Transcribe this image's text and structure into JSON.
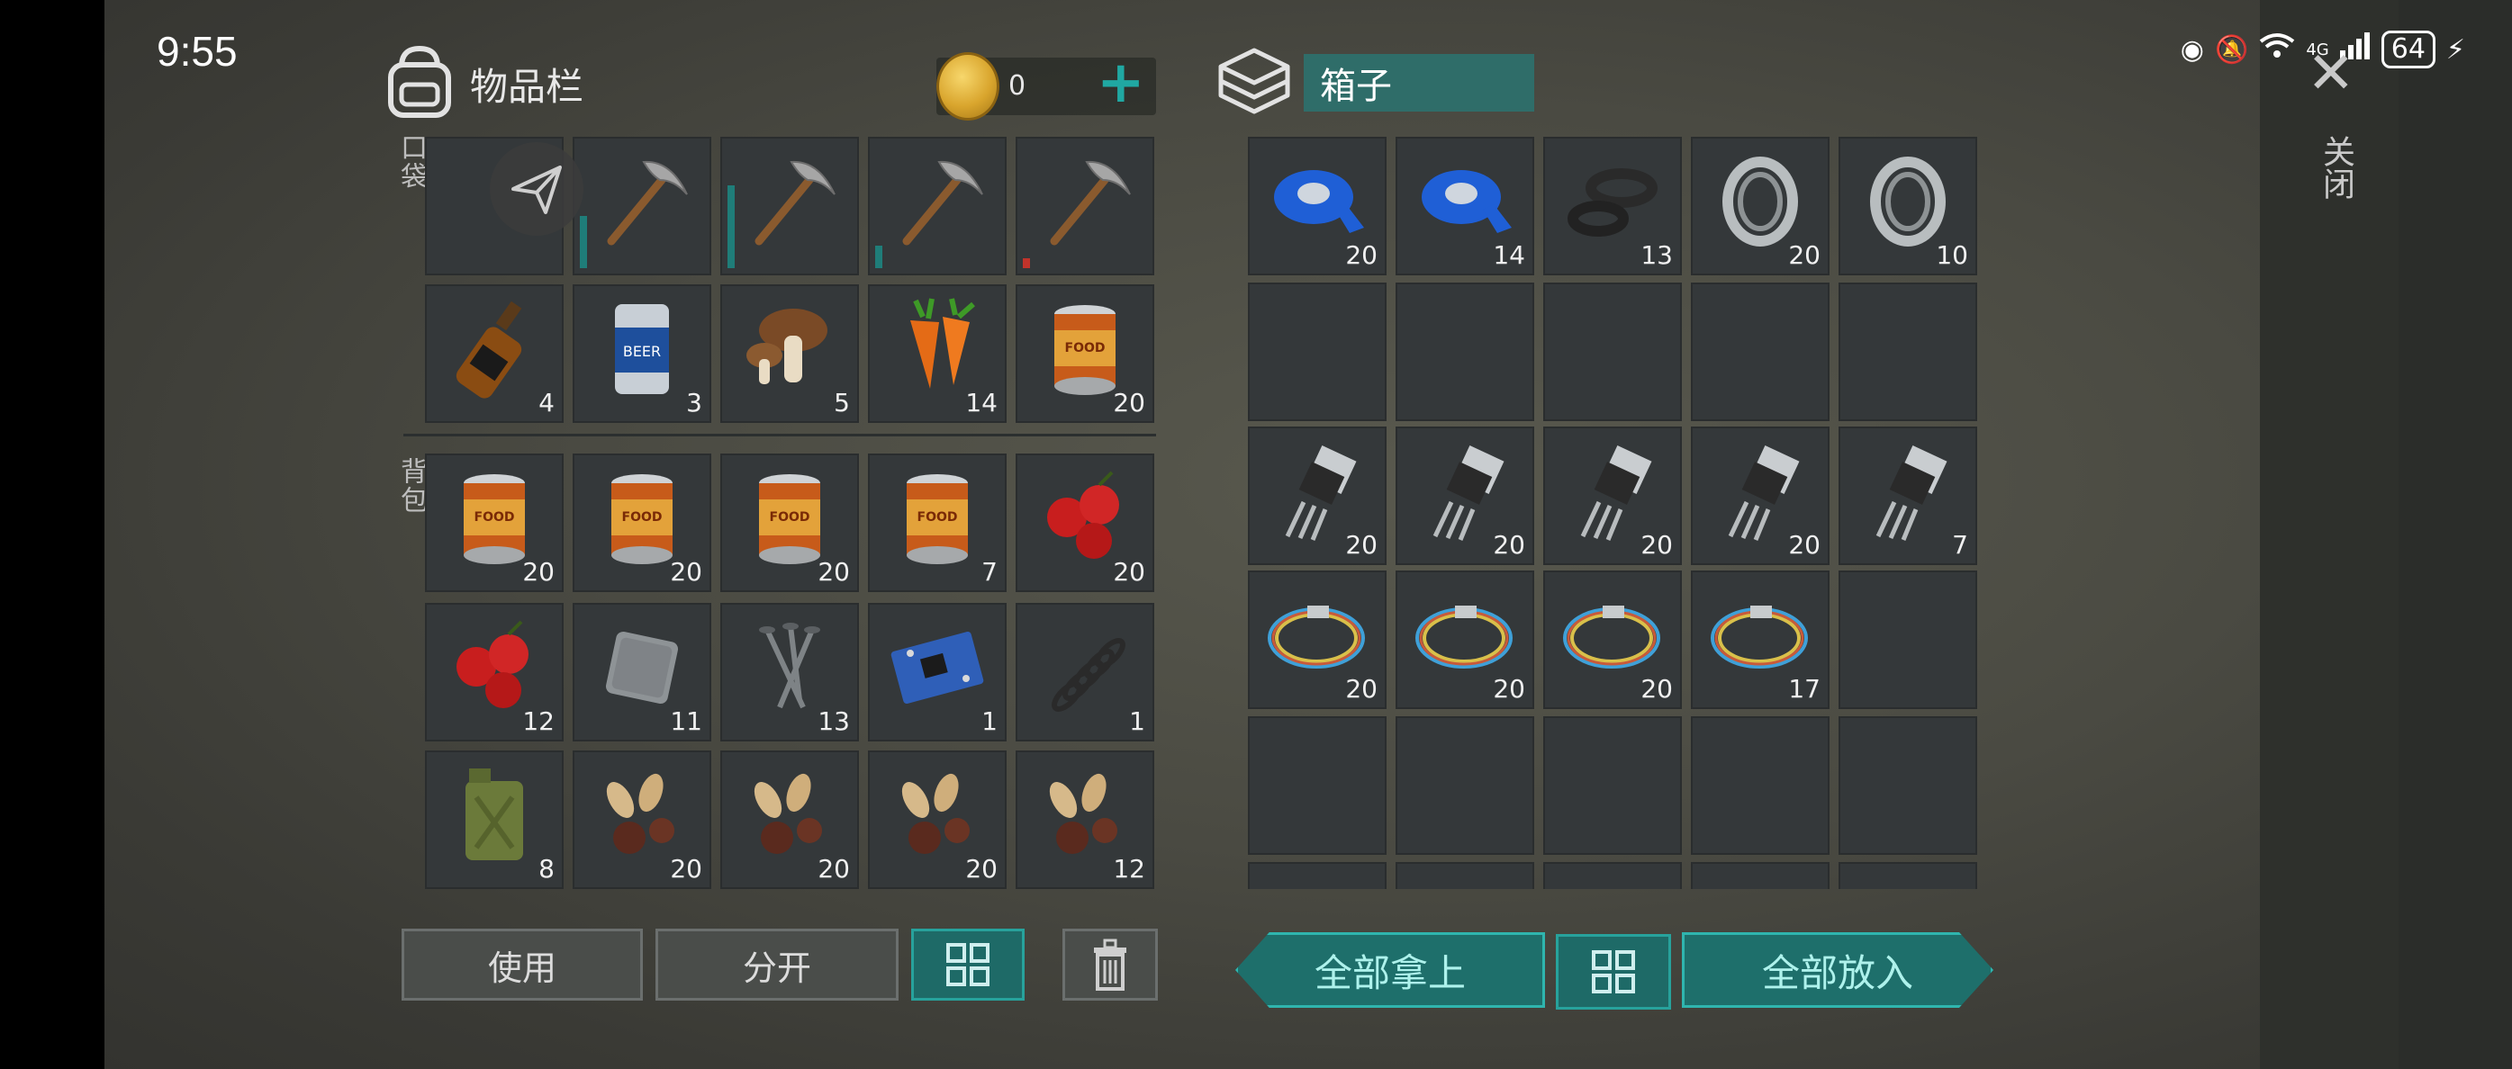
{
  "status": {
    "time": "9:55",
    "battery": "64",
    "network": "4G"
  },
  "inventory": {
    "title": "物品栏",
    "coins": "0",
    "pocket_label": "口袋",
    "backpack_label": "背包",
    "pocket": [
      {
        "icon": "pickaxe",
        "count": "",
        "durability": 0.62,
        "dur_color": "#1f7d79"
      },
      {
        "icon": "pickaxe",
        "count": "",
        "durability": 0.98,
        "dur_color": "#1f7d79"
      },
      {
        "icon": "pickaxe",
        "count": "",
        "durability": 0.27,
        "dur_color": "#1f7d79"
      },
      {
        "icon": "pickaxe",
        "count": "",
        "durability": 0.12,
        "dur_color": "#c0332b"
      },
      {
        "icon": "whiskey-bottle",
        "count": "4"
      },
      {
        "icon": "beer-can",
        "count": "3"
      },
      {
        "icon": "mushroom",
        "count": "5"
      },
      {
        "icon": "carrot",
        "count": "14"
      },
      {
        "icon": "food-can",
        "count": "20"
      }
    ],
    "backpack": [
      {
        "icon": "food-can",
        "count": "20"
      },
      {
        "icon": "food-can",
        "count": "20"
      },
      {
        "icon": "food-can",
        "count": "20"
      },
      {
        "icon": "food-can",
        "count": "7"
      },
      {
        "icon": "berries",
        "count": "20"
      },
      {
        "icon": "berries",
        "count": "12"
      },
      {
        "icon": "metal-plate",
        "count": "11"
      },
      {
        "icon": "nails",
        "count": "13"
      },
      {
        "icon": "circuit-board",
        "count": "1"
      },
      {
        "icon": "spring",
        "count": "1"
      },
      {
        "icon": "jerry-can",
        "count": "8"
      },
      {
        "icon": "seeds",
        "count": "20"
      },
      {
        "icon": "seeds",
        "count": "20"
      },
      {
        "icon": "seeds",
        "count": "20"
      },
      {
        "icon": "seeds",
        "count": "12"
      }
    ],
    "buttons": {
      "use": "使用",
      "split": "分开"
    }
  },
  "box": {
    "title": "箱子",
    "items": [
      {
        "icon": "blue-tape",
        "count": "20"
      },
      {
        "icon": "blue-tape",
        "count": "14"
      },
      {
        "icon": "rubber-rings",
        "count": "13"
      },
      {
        "icon": "bearing",
        "count": "20"
      },
      {
        "icon": "bearing",
        "count": "10"
      },
      {
        "icon": "",
        "count": ""
      },
      {
        "icon": "",
        "count": ""
      },
      {
        "icon": "",
        "count": ""
      },
      {
        "icon": "",
        "count": ""
      },
      {
        "icon": "",
        "count": ""
      },
      {
        "icon": "transistor",
        "count": "20"
      },
      {
        "icon": "transistor",
        "count": "20"
      },
      {
        "icon": "transistor",
        "count": "20"
      },
      {
        "icon": "transistor",
        "count": "20"
      },
      {
        "icon": "transistor",
        "count": "7"
      },
      {
        "icon": "wire",
        "count": "20"
      },
      {
        "icon": "wire",
        "count": "20"
      },
      {
        "icon": "wire",
        "count": "20"
      },
      {
        "icon": "wire",
        "count": "17"
      },
      {
        "icon": "",
        "count": ""
      },
      {
        "icon": "",
        "count": ""
      },
      {
        "icon": "",
        "count": ""
      },
      {
        "icon": "",
        "count": ""
      },
      {
        "icon": "",
        "count": ""
      },
      {
        "icon": "",
        "count": ""
      }
    ],
    "buttons": {
      "take_all": "全部拿上",
      "put_all": "全部放入"
    }
  },
  "close": {
    "label": "关闭"
  },
  "colors": {
    "accent": "#20a8a2",
    "slot": "#34383a",
    "teal_dark": "#1e6a67"
  }
}
